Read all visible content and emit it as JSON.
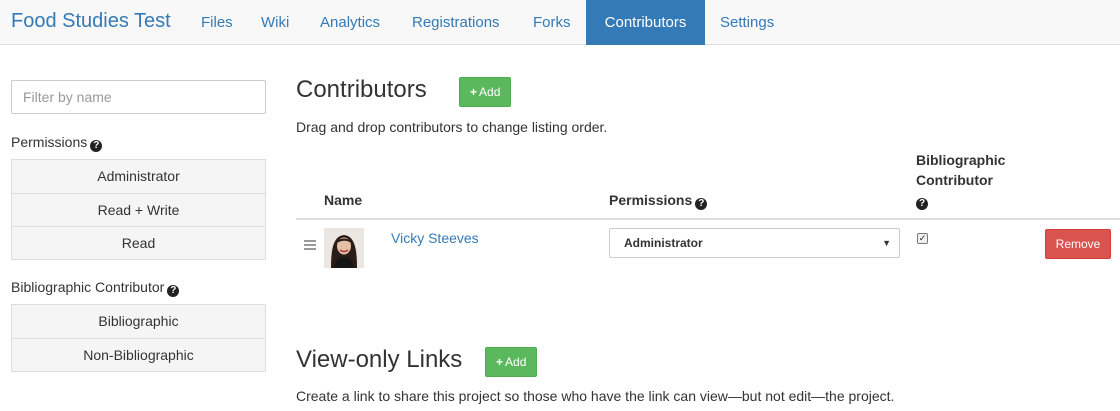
{
  "nav": {
    "brand": "Food Studies Test",
    "tabs": [
      {
        "label": "Files"
      },
      {
        "label": "Wiki"
      },
      {
        "label": "Analytics"
      },
      {
        "label": "Registrations"
      },
      {
        "label": "Forks"
      },
      {
        "label": "Contributors",
        "active": true
      },
      {
        "label": "Settings"
      }
    ]
  },
  "sidebar": {
    "filter_placeholder": "Filter by name",
    "permissions_heading": "Permissions",
    "permissions_options": [
      "Administrator",
      "Read + Write",
      "Read"
    ],
    "bibliographic_heading": "Bibliographic Contributor",
    "bibliographic_options": [
      "Bibliographic",
      "Non-Bibliographic"
    ]
  },
  "contributors": {
    "title": "Contributors",
    "add_label": "Add",
    "help": "Drag and drop contributors to change listing order.",
    "columns": {
      "name": "Name",
      "permissions": "Permissions",
      "bibliographic_line1": "Bibliographic",
      "bibliographic_line2": "Contributor"
    },
    "rows": [
      {
        "name": "Vicky Steeves",
        "permission": "Administrator",
        "bibliographic": true,
        "remove_label": "Remove"
      }
    ]
  },
  "view_only": {
    "title": "View-only Links",
    "add_label": "Add",
    "help": "Create a link to share this project so those who have the link can view—but not edit—the project."
  },
  "colors": {
    "link": "#337ab7",
    "add_button": "#5cb85c",
    "remove_button": "#d9534f"
  },
  "icons": [
    "question-circle-icon",
    "plus-icon",
    "drag-handle-icon",
    "caret-down-icon",
    "check-icon"
  ]
}
